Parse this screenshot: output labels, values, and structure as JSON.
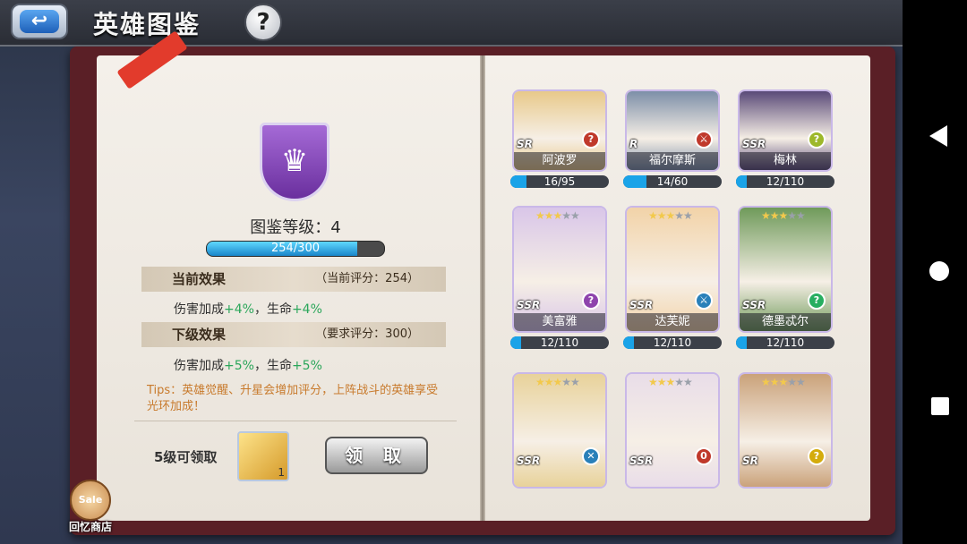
{
  "header": {
    "title": "英雄图鉴",
    "back_icon": "back-arrow-icon",
    "help_label": "?"
  },
  "left_page": {
    "collection_level_label": "图鉴等级：4",
    "xp": {
      "text": "254/300",
      "current": 254,
      "max": 300
    },
    "current_effect": {
      "title": "当前效果",
      "score": "（当前评分：254）",
      "line_prefix": "伤害加成",
      "damage": "+4%",
      "sep": "，生命",
      "hp": "+4%"
    },
    "next_effect": {
      "title": "下级效果",
      "score": "（要求评分：300）",
      "line_prefix": "伤害加成",
      "damage": "+5%",
      "sep": "，生命",
      "hp": "+5%"
    },
    "tips": "Tips：英雄觉醒、升星会增加评分，上阵战斗的英雄享受光环加成！",
    "reward_label": "5级可领取",
    "reward_count": "1",
    "claim_button": "领 取",
    "shop": {
      "badge": "Sale",
      "label": "回忆商店"
    }
  },
  "heroes": [
    {
      "name": "阿波罗",
      "rarity": "SR",
      "stars": 0,
      "class_icon": "?",
      "color": "#c0392b",
      "progress_text": "16/95",
      "progress": 0.168,
      "bg": "#e8c98a"
    },
    {
      "name": "福尔摩斯",
      "rarity": "R",
      "stars": 0,
      "class_icon": "⚔",
      "color": "#c0392b",
      "progress_text": "14/60",
      "progress": 0.233,
      "bg": "#7d8fa8"
    },
    {
      "name": "梅林",
      "rarity": "SSR",
      "stars": 0,
      "class_icon": "?",
      "color": "#9db82a",
      "progress_text": "12/110",
      "progress": 0.109,
      "bg": "#5a4a78"
    },
    {
      "name": "美富雅",
      "rarity": "SSR",
      "stars": 3,
      "class_icon": "?",
      "color": "#8e44ad",
      "progress_text": "12/110",
      "progress": 0.109,
      "bg": "#d9c6e8"
    },
    {
      "name": "达芙妮",
      "rarity": "SSR",
      "stars": 3,
      "class_icon": "⚔",
      "color": "#2980b9",
      "progress_text": "12/110",
      "progress": 0.109,
      "bg": "#f2d3a8"
    },
    {
      "name": "德墨忒尔",
      "rarity": "SSR",
      "stars": 3,
      "class_icon": "?",
      "color": "#27ae60",
      "progress_text": "12/110",
      "progress": 0.109,
      "bg": "#6f9a5a"
    },
    {
      "name": "",
      "rarity": "SSR",
      "stars": 3,
      "class_icon": "✕",
      "color": "#2980b9",
      "progress_text": "",
      "progress": 0,
      "bg": "#e8d29a"
    },
    {
      "name": "",
      "rarity": "SSR",
      "stars": 3,
      "class_icon": "0",
      "color": "#c0392b",
      "progress_text": "",
      "progress": 0,
      "bg": "#e9dde8"
    },
    {
      "name": "",
      "rarity": "SR",
      "stars": 3,
      "class_icon": "?",
      "color": "#d4ac0d",
      "progress_text": "",
      "progress": 0,
      "bg": "#caa27a"
    }
  ]
}
